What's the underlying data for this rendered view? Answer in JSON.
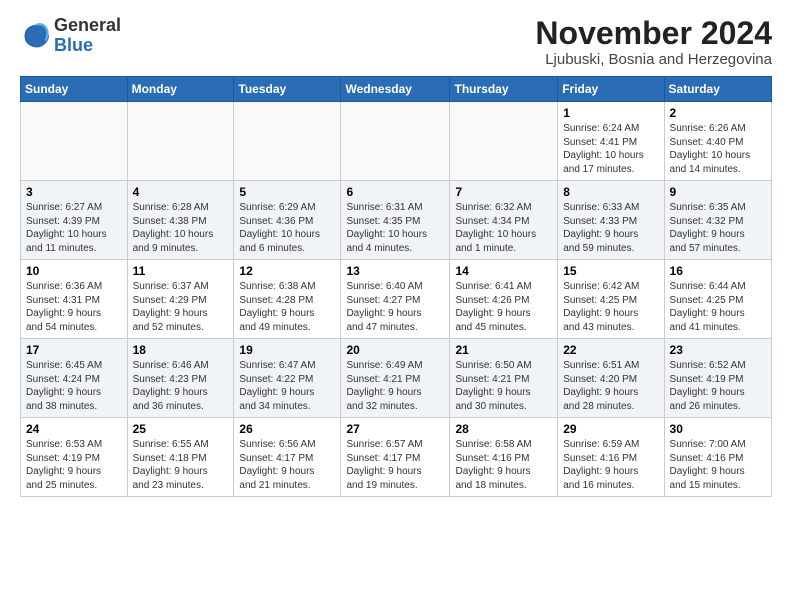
{
  "logo": {
    "general": "General",
    "blue": "Blue"
  },
  "title": "November 2024",
  "location": "Ljubuski, Bosnia and Herzegovina",
  "days_of_week": [
    "Sunday",
    "Monday",
    "Tuesday",
    "Wednesday",
    "Thursday",
    "Friday",
    "Saturday"
  ],
  "weeks": [
    [
      {
        "day": "",
        "info": ""
      },
      {
        "day": "",
        "info": ""
      },
      {
        "day": "",
        "info": ""
      },
      {
        "day": "",
        "info": ""
      },
      {
        "day": "",
        "info": ""
      },
      {
        "day": "1",
        "info": "Sunrise: 6:24 AM\nSunset: 4:41 PM\nDaylight: 10 hours\nand 17 minutes."
      },
      {
        "day": "2",
        "info": "Sunrise: 6:26 AM\nSunset: 4:40 PM\nDaylight: 10 hours\nand 14 minutes."
      }
    ],
    [
      {
        "day": "3",
        "info": "Sunrise: 6:27 AM\nSunset: 4:39 PM\nDaylight: 10 hours\nand 11 minutes."
      },
      {
        "day": "4",
        "info": "Sunrise: 6:28 AM\nSunset: 4:38 PM\nDaylight: 10 hours\nand 9 minutes."
      },
      {
        "day": "5",
        "info": "Sunrise: 6:29 AM\nSunset: 4:36 PM\nDaylight: 10 hours\nand 6 minutes."
      },
      {
        "day": "6",
        "info": "Sunrise: 6:31 AM\nSunset: 4:35 PM\nDaylight: 10 hours\nand 4 minutes."
      },
      {
        "day": "7",
        "info": "Sunrise: 6:32 AM\nSunset: 4:34 PM\nDaylight: 10 hours\nand 1 minute."
      },
      {
        "day": "8",
        "info": "Sunrise: 6:33 AM\nSunset: 4:33 PM\nDaylight: 9 hours\nand 59 minutes."
      },
      {
        "day": "9",
        "info": "Sunrise: 6:35 AM\nSunset: 4:32 PM\nDaylight: 9 hours\nand 57 minutes."
      }
    ],
    [
      {
        "day": "10",
        "info": "Sunrise: 6:36 AM\nSunset: 4:31 PM\nDaylight: 9 hours\nand 54 minutes."
      },
      {
        "day": "11",
        "info": "Sunrise: 6:37 AM\nSunset: 4:29 PM\nDaylight: 9 hours\nand 52 minutes."
      },
      {
        "day": "12",
        "info": "Sunrise: 6:38 AM\nSunset: 4:28 PM\nDaylight: 9 hours\nand 49 minutes."
      },
      {
        "day": "13",
        "info": "Sunrise: 6:40 AM\nSunset: 4:27 PM\nDaylight: 9 hours\nand 47 minutes."
      },
      {
        "day": "14",
        "info": "Sunrise: 6:41 AM\nSunset: 4:26 PM\nDaylight: 9 hours\nand 45 minutes."
      },
      {
        "day": "15",
        "info": "Sunrise: 6:42 AM\nSunset: 4:25 PM\nDaylight: 9 hours\nand 43 minutes."
      },
      {
        "day": "16",
        "info": "Sunrise: 6:44 AM\nSunset: 4:25 PM\nDaylight: 9 hours\nand 41 minutes."
      }
    ],
    [
      {
        "day": "17",
        "info": "Sunrise: 6:45 AM\nSunset: 4:24 PM\nDaylight: 9 hours\nand 38 minutes."
      },
      {
        "day": "18",
        "info": "Sunrise: 6:46 AM\nSunset: 4:23 PM\nDaylight: 9 hours\nand 36 minutes."
      },
      {
        "day": "19",
        "info": "Sunrise: 6:47 AM\nSunset: 4:22 PM\nDaylight: 9 hours\nand 34 minutes."
      },
      {
        "day": "20",
        "info": "Sunrise: 6:49 AM\nSunset: 4:21 PM\nDaylight: 9 hours\nand 32 minutes."
      },
      {
        "day": "21",
        "info": "Sunrise: 6:50 AM\nSunset: 4:21 PM\nDaylight: 9 hours\nand 30 minutes."
      },
      {
        "day": "22",
        "info": "Sunrise: 6:51 AM\nSunset: 4:20 PM\nDaylight: 9 hours\nand 28 minutes."
      },
      {
        "day": "23",
        "info": "Sunrise: 6:52 AM\nSunset: 4:19 PM\nDaylight: 9 hours\nand 26 minutes."
      }
    ],
    [
      {
        "day": "24",
        "info": "Sunrise: 6:53 AM\nSunset: 4:19 PM\nDaylight: 9 hours\nand 25 minutes."
      },
      {
        "day": "25",
        "info": "Sunrise: 6:55 AM\nSunset: 4:18 PM\nDaylight: 9 hours\nand 23 minutes."
      },
      {
        "day": "26",
        "info": "Sunrise: 6:56 AM\nSunset: 4:17 PM\nDaylight: 9 hours\nand 21 minutes."
      },
      {
        "day": "27",
        "info": "Sunrise: 6:57 AM\nSunset: 4:17 PM\nDaylight: 9 hours\nand 19 minutes."
      },
      {
        "day": "28",
        "info": "Sunrise: 6:58 AM\nSunset: 4:16 PM\nDaylight: 9 hours\nand 18 minutes."
      },
      {
        "day": "29",
        "info": "Sunrise: 6:59 AM\nSunset: 4:16 PM\nDaylight: 9 hours\nand 16 minutes."
      },
      {
        "day": "30",
        "info": "Sunrise: 7:00 AM\nSunset: 4:16 PM\nDaylight: 9 hours\nand 15 minutes."
      }
    ]
  ]
}
